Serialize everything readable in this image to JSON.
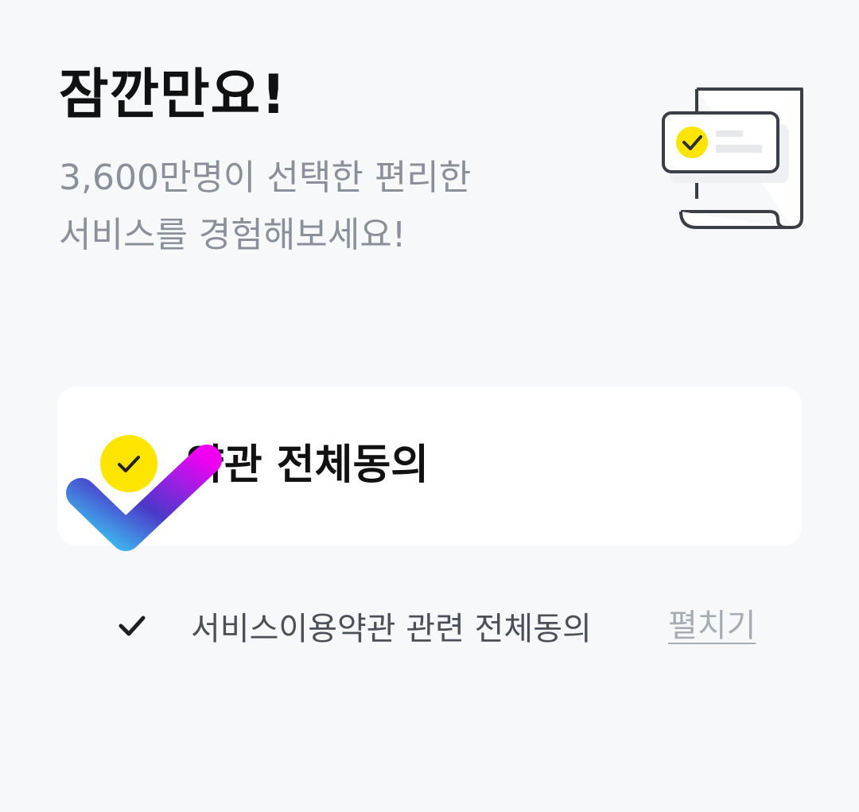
{
  "header": {
    "title": "잠깐만요!",
    "subtitle_line1": "3,600만명이 선택한 편리한",
    "subtitle_line2": "서비스를 경험해보세요!"
  },
  "agree_all": {
    "label": "약관 전체동의",
    "checked": true,
    "accent_color": "#fde500"
  },
  "sub_items": [
    {
      "label": "서비스이용약관 관련 전체동의",
      "checked": true,
      "expand_label": "펼치기"
    }
  ],
  "icons": {
    "illustration": "document-check-illustration",
    "agree_all_check": "check-circle-icon",
    "sub_check": "check-icon",
    "overlay": "gradient-check-icon"
  },
  "colors": {
    "background": "#f7f8fa",
    "card": "#ffffff",
    "accent": "#fde500",
    "title": "#111111",
    "subtitle": "#8a909a"
  }
}
